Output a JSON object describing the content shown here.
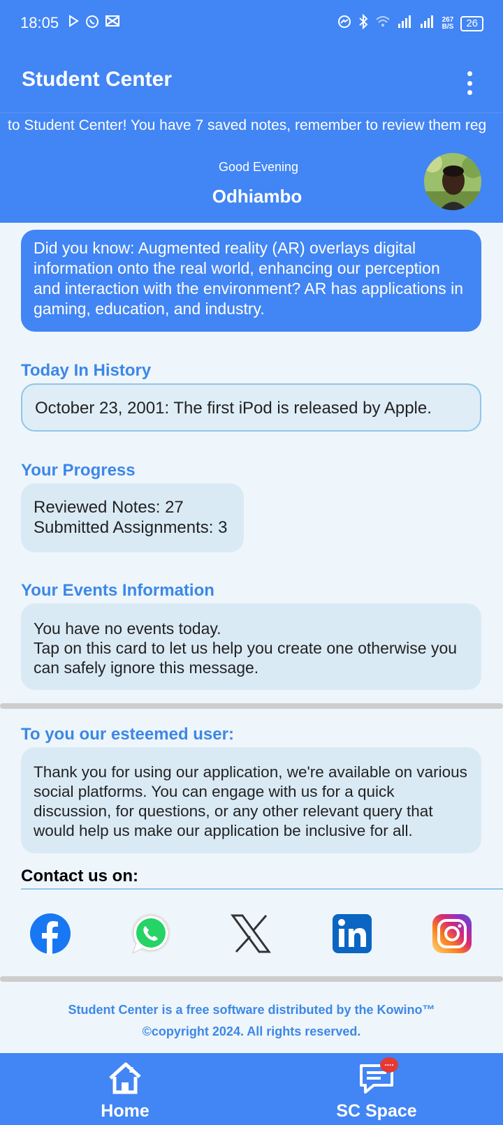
{
  "status_bar": {
    "time": "18:05",
    "net_speed": "267\nB/S",
    "battery": "26"
  },
  "app_bar": {
    "title": "Student Center"
  },
  "ticker": {
    "text": "to Student Center!  You have 7 saved notes, remember to review them reg"
  },
  "greeting": {
    "salutation": "Good Evening",
    "name": "Odhiambo"
  },
  "fact": {
    "text": "Did you know: Augmented reality (AR) overlays digital information onto the real world, enhancing our perception and interaction with the environment? AR has applications in gaming, education, and industry."
  },
  "history": {
    "heading": "Today In History",
    "text": "October 23, 2001: The first iPod is released by Apple."
  },
  "progress": {
    "heading": "Your Progress",
    "reviewed": "Reviewed Notes: 27",
    "submitted": "Submitted Assignments: 3"
  },
  "events": {
    "heading": "Your Events Information",
    "line1": "You have no events today.",
    "line2": "Tap on this card to let us help you create one otherwise you can safely ignore this message."
  },
  "esteemed": {
    "heading": "To you our esteemed user:",
    "text": "Thank you for using our application, we're available on various social platforms. You can engage with us for a quick discussion, for questions, or any other relevant query that would help us make our application be inclusive for all."
  },
  "contact": {
    "heading": "Contact us on:",
    "icons": [
      "facebook-icon",
      "whatsapp-icon",
      "x-icon",
      "linkedin-icon",
      "instagram-icon"
    ]
  },
  "footer": {
    "line1": "Student Center is a free software distributed by the Kowino™",
    "line2": "©copyright 2024. All rights reserved."
  },
  "bottom_nav": {
    "home": "Home",
    "space": "SC Space",
    "badge": "...."
  },
  "colors": {
    "primary": "#4285F4",
    "accent_text": "#3D87E6",
    "card_bg": "#DAEAF5",
    "page_bg": "#EEF6FC"
  }
}
